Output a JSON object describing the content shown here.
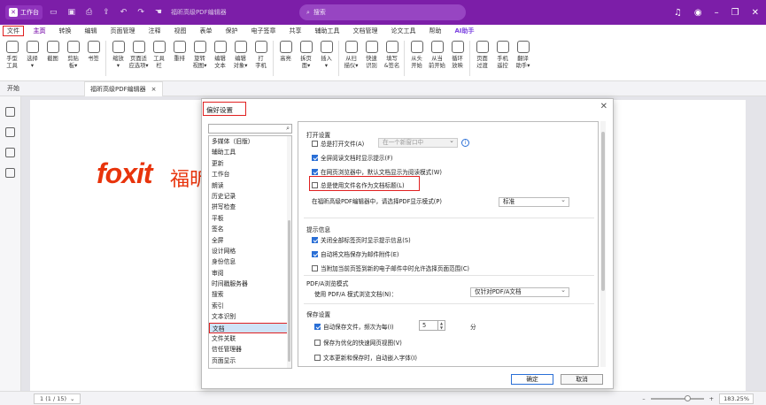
{
  "titlebar": {
    "app_label": "工作台",
    "logo_glyph": "✕",
    "doc_title": "福昕高级PDF编辑器",
    "search_placeholder": "搜索",
    "icons": [
      "folder-icon",
      "save-icon",
      "print-icon",
      "share-icon",
      "undo-icon",
      "redo-icon",
      "hand-icon",
      "bell-icon",
      "user-icon",
      "minimize-icon",
      "restore-icon",
      "close-icon"
    ]
  },
  "menu": [
    "文件",
    "主页",
    "转换",
    "编辑",
    "页面管理",
    "注释",
    "视图",
    "表单",
    "保护",
    "电子签章",
    "共享",
    "辅助工具",
    "文档管理",
    "论文工具",
    "帮助",
    "AI助手"
  ],
  "ribbon": [
    "手型\n工具",
    "选择\n▾",
    "截图",
    "剪贴\n板▾",
    "书签",
    "缩放\n▾",
    "页面适\n应选项▾",
    "工具\n栏",
    "重排",
    "旋转\n视图▾",
    "编辑\n文本",
    "编辑\n对象▾",
    "打\n字机",
    "高亮",
    "拆页\n面▾",
    "插入\n▾",
    "从扫\n描仪▾",
    "快速\n识别",
    "填写\n&签名",
    "从头\n开始",
    "从当\n前开始",
    "循环\n放映",
    "页面\n过渡",
    "手机\n遥控",
    "翻译\n助手▾"
  ],
  "tabs": {
    "start": "开始",
    "doc": "福昕高级PDF编辑器",
    "close": "×"
  },
  "page": {
    "logo_text": "foxit",
    "logo_cn": "福昕"
  },
  "status": {
    "page": "1 (1 / 15)",
    "zoom": "183.25%"
  },
  "dialog": {
    "title": "偏好设置",
    "close": "✕",
    "categories": [
      "多媒体（旧版）",
      "辅助工具",
      "更新",
      "工作台",
      "朗读",
      "历史记录",
      "拼写检查",
      "平板",
      "签名",
      "全屏",
      "设计网格",
      "身份信息",
      "审阅",
      "时间戳服务器",
      "搜索",
      "索引",
      "文本识别",
      "文档",
      "文件关联",
      "信任管理器",
      "页面显示"
    ],
    "selected_category": "文档",
    "open_section": "打开设置",
    "opt_always_open_file": "总是打开文件(A)",
    "opt_always_open_value": "在一个新窗口中",
    "opt_fullscreen_prompt": "全屏阅读文档时显示提示(F)",
    "opt_browser_read_mode": "在网页浏览器中，默认文档显示为阅读模式(W)",
    "opt_filename_as_title": "总是使用文件名作为文档标题(L)",
    "pdf_display_label": "在福昕高级PDF编辑器中，请选择PDF显示模式(P)",
    "pdf_display_value": "标准",
    "tip_section": "提示信息",
    "opt_close_all_tabs": "关闭全部标签页时显示提示信息(S)",
    "opt_auto_save_mail": "自动将文档保存为邮件附件(E)",
    "opt_add_page_range": "当附加当前页签到新的电子邮件中时允许选择页面范围(C)",
    "pdfa_section": "PDF/A浏览模式",
    "pdfa_label": "使用 PDF/A 模式浏览文档(N)：",
    "pdfa_value": "仅针对PDF/A文档",
    "save_section": "保存设置",
    "opt_autosave": "自动保存文件，频次为每(I)",
    "autosave_value": "5",
    "autosave_unit": "分",
    "opt_save_optimized": "保存为优化的快速网页视图(V)",
    "opt_embed_fonts": "文本更新和保存时，自动嵌入字体(I)",
    "ok": "确定",
    "cancel": "取消"
  }
}
